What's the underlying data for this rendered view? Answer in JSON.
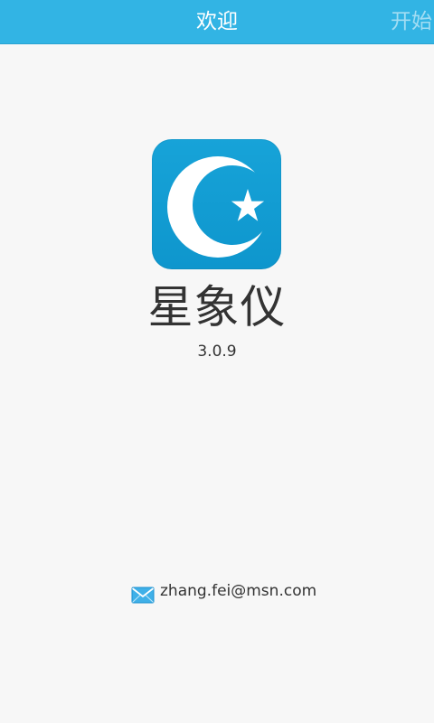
{
  "tabs": {
    "active_label": "欢迎",
    "next_label": "开始"
  },
  "app": {
    "icon": "crescent-star-icon",
    "name": "星象仪",
    "version": "3.0.9"
  },
  "contact": {
    "icon": "mail-icon",
    "email": "zhang.fei@msn.com"
  },
  "colors": {
    "tabbar": "#32b4e4",
    "icon_background": "#0e96cd",
    "background": "#f7f7f7",
    "text": "#333333"
  }
}
